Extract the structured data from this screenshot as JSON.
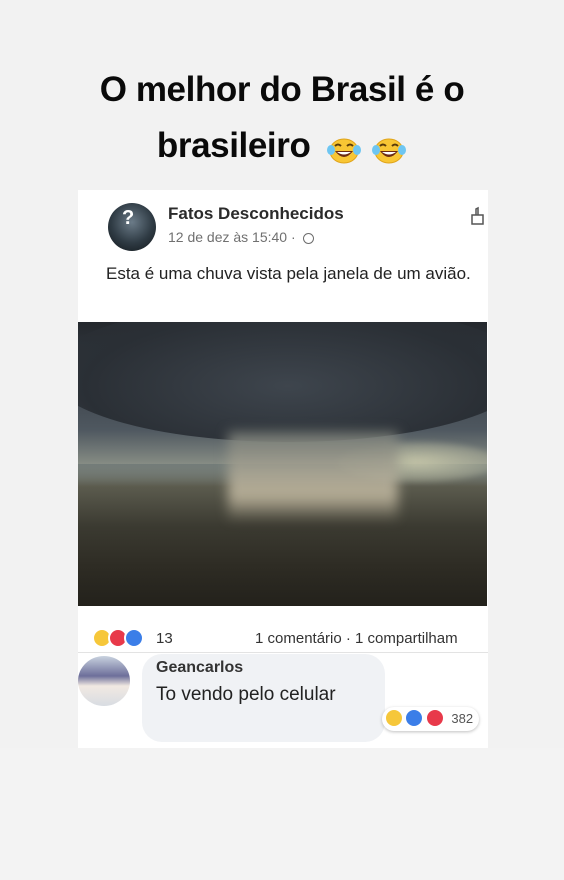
{
  "story": {
    "caption_line1": "O melhor do Brasil é o",
    "caption_line2": "brasileiro",
    "caption_emoji_icons": [
      "laughing-tears-icon",
      "laughing-tears-icon"
    ]
  },
  "post": {
    "page_name": "Fatos Desconhecidos",
    "timestamp": "12 de dez às 15:40 ·",
    "privacy_icon": "globe-icon",
    "corner_icon": "like-outline-icon",
    "text": "Esta é uma chuva vista pela janela de um avião.",
    "photo_icon": "rain-over-landscape-photo",
    "reaction_icons": [
      "wow-icon",
      "love-icon",
      "like-icon"
    ],
    "reaction_count": "13",
    "stats": "1 comentário · 1 compartilham"
  },
  "comment": {
    "author": "Geancarlos",
    "text": "To vendo pelo celular",
    "reaction_icons": [
      "haha-icon",
      "like-icon",
      "love-icon"
    ],
    "reaction_count": "382"
  },
  "colors": {
    "like_blue": "#3b7ee8",
    "love_red": "#e8394a",
    "wow_yellow": "#f6c73a",
    "bubble_grey": "#f0f2f5"
  }
}
